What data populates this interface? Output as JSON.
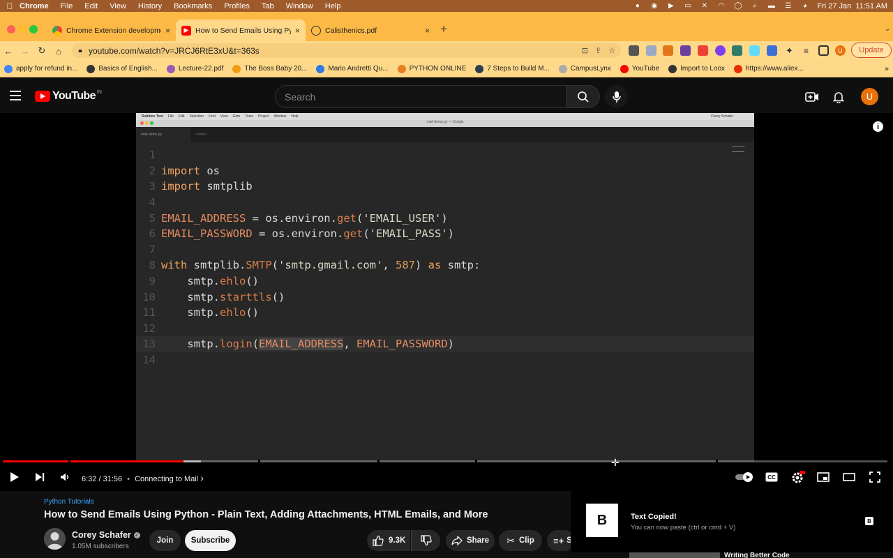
{
  "menubar": {
    "app": "Chrome",
    "items": [
      "File",
      "Edit",
      "View",
      "History",
      "Bookmarks",
      "Profiles",
      "Tab",
      "Window",
      "Help"
    ],
    "datetime": "Fri 27 Jan  11:51 AM"
  },
  "tabs": [
    {
      "title": "Chrome Extension developmen",
      "icon": "chrome-icon",
      "close": "×"
    },
    {
      "title": "How to Send Emails Using Pyth",
      "icon": "youtube-icon",
      "close": "×"
    },
    {
      "title": "Calisthenics.pdf",
      "icon": "globe-icon",
      "close": "×"
    }
  ],
  "new_tab": "+",
  "toolbar": {
    "url": "youtube.com/watch?v=JRCJ6RtE3xU&t=363s",
    "update_label": "Update",
    "profile_initial": "U"
  },
  "bookmarks": [
    {
      "label": "apply for refund in...",
      "icon": "google-icon",
      "color": "#4285f4"
    },
    {
      "label": "Basics of English...",
      "icon": "globe-icon",
      "color": "#333333"
    },
    {
      "label": "Lecture-22.pdf",
      "icon": "pdf-icon",
      "color": "#9b59b6"
    },
    {
      "label": "The Boss Baby 20...",
      "icon": "film-icon",
      "color": "#f39c12"
    },
    {
      "label": "Mario Andretti Qu...",
      "icon": "quote-icon",
      "color": "#2c7be5"
    },
    {
      "label": "PYTHON ONLINE",
      "icon": "python-icon",
      "color": "#e67e22"
    },
    {
      "label": "7 Steps to Build M...",
      "icon": "triangle-icon",
      "color": "#2c3e50"
    },
    {
      "label": "CampusLynx",
      "icon": "dot-icon",
      "color": "#aaaaaa"
    },
    {
      "label": "YouTube",
      "icon": "youtube-icon",
      "color": "#ff0000"
    },
    {
      "label": "Import to Loox",
      "icon": "globe-icon",
      "color": "#333333"
    },
    {
      "label": "https://www.aliex...",
      "icon": "aliexpress-icon",
      "color": "#e62e04"
    }
  ],
  "youtube": {
    "logo_text": "YouTube",
    "region": "IN",
    "search_placeholder": "Search",
    "avatar": "U"
  },
  "editor": {
    "menu": [
      "Sublime Text",
      "File",
      "Edit",
      "Selection",
      "Find",
      "View",
      "Goto",
      "Tools",
      "Project",
      "Window",
      "Help"
    ],
    "user": "Corey Schafer",
    "window_title": "mail-demo.py — Scripts",
    "tab1": "mail-demo.py",
    "tab2": "untitled"
  },
  "code": {
    "l1": "",
    "l2a": "import",
    "l2b": " os",
    "l3a": "import",
    "l3b": " smtplib",
    "l4": "",
    "l5a": "EMAIL_ADDRESS",
    "l5b": " = os.environ.",
    "l5c": "get",
    "l5d": "(",
    "l5e": "'EMAIL_USER'",
    "l5f": ")",
    "l6a": "EMAIL_PASSWORD",
    "l6b": " = os.environ.",
    "l6c": "get",
    "l6d": "(",
    "l6e": "'EMAIL_PASS'",
    "l6f": ")",
    "l7": "",
    "l8a": "with",
    "l8b": " smtplib.",
    "l8c": "SMTP",
    "l8d": "(",
    "l8e": "'smtp.gmail.com'",
    "l8f": ", ",
    "l8g": "587",
    "l8h": ") ",
    "l8i": "as",
    "l8j": " smtp:",
    "l9a": "    smtp.",
    "l9b": "ehlo",
    "l9c": "()",
    "l10a": "    smtp.",
    "l10b": "starttls",
    "l10c": "()",
    "l11a": "    smtp.",
    "l11b": "ehlo",
    "l11c": "()",
    "l12": "",
    "l13a": "    smtp.",
    "l13b": "login",
    "l13c": "(",
    "l13d": "EMAIL_ADDRESS",
    "l13e": ", ",
    "l13f": "EMAIL_PASSWORD",
    "l13g": ")",
    "l14": "",
    "line_numbers": [
      "1",
      "2",
      "3",
      "4",
      "5",
      "6",
      "7",
      "8",
      "9",
      "10",
      "11",
      "12",
      "13",
      "14"
    ]
  },
  "player": {
    "time": "6:32 / 31:56",
    "separator": "•",
    "chapter": "Connecting to Mail",
    "chapter_arrow": "›",
    "progress_fraction": 0.204
  },
  "video": {
    "playlist": "Python Tutorials",
    "title": "How to Send Emails Using Python - Plain Text, Adding Attachments, HTML Emails, and More",
    "channel": "Corey Schafer",
    "subscribers": "1.05M subscribers",
    "join_label": "Join",
    "subscribe_label": "Subscribe",
    "likes": "9.3K",
    "share_label": "Share",
    "clip_label": "Clip",
    "save_label": "S"
  },
  "toast": {
    "logo": "B",
    "title": "Text Copied!",
    "subtitle": "You can now paste (ctrl or cmd + V)"
  },
  "next_video_title": "Writing Better Code"
}
